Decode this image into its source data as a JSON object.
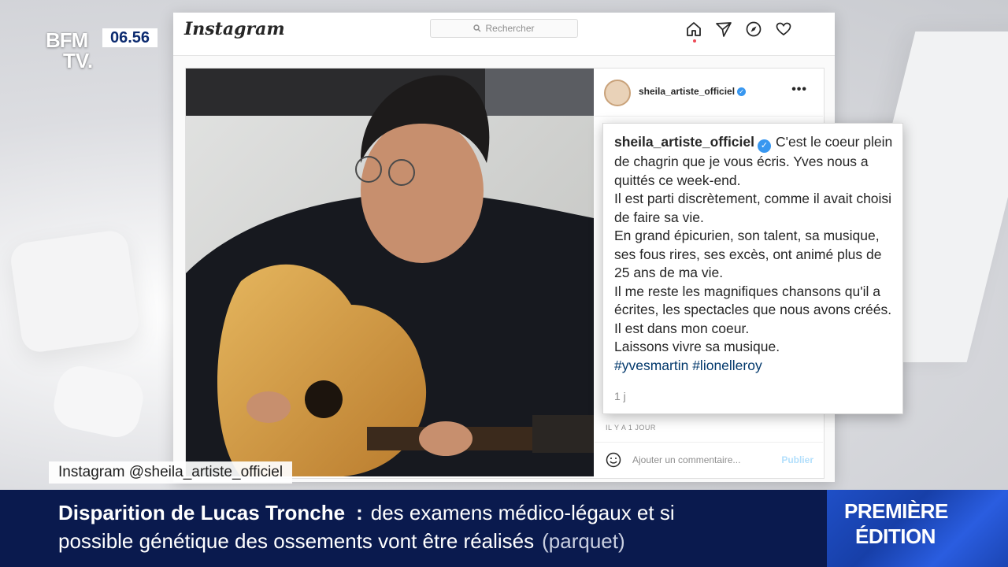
{
  "broadcast": {
    "logo_line1": "BFM",
    "logo_line2": "TV.",
    "clock": "06.56",
    "source_label": "Instagram @sheila_artiste_officiel",
    "headline_bold": "Disparition de Lucas Tronche",
    "headline_sep": ":",
    "headline_rest": "des examens médico-légaux et si",
    "headline_line2": "possible génétique des ossements vont être réalisés",
    "headline_source": "(parquet)",
    "brand_line1": "PREMIÈRE",
    "brand_line2": "ÉDITION"
  },
  "instagram": {
    "wordmark": "Instagram",
    "search_placeholder": "Rechercher",
    "nav_icons": [
      "home-icon",
      "direct-message-icon",
      "explore-icon",
      "heart-icon"
    ],
    "post": {
      "username": "sheila_artiste_officiel",
      "verified": true,
      "more_label": "•••",
      "time_label": "IL Y A 1 JOUR",
      "comment_placeholder": "Ajouter un commentaire...",
      "publish_label": "Publier"
    },
    "caption": {
      "username": "sheila_artiste_officiel",
      "lines": [
        "C'est le coeur plein de chagrin que je vous écris. Yves nous a quittés ce week-end.",
        "Il est parti discrètement, comme il avait choisi de faire sa vie.",
        "En grand épicurien, son talent, sa musique, ses fous rires, ses excès, ont animé plus de 25 ans de ma vie.",
        "Il me reste les magnifiques chansons qu'il a écrites, les spectacles que nous avons créés. Il est dans mon coeur.",
        "Laissons vivre sa musique."
      ],
      "hashtags": "#yvesmartin #lionelleroy",
      "age": "1 j"
    }
  },
  "colors": {
    "ticker_bg": "#0a1a4e",
    "brand_bg": "#1f4fc7",
    "verified": "#3897f0",
    "hashtag": "#00376b"
  }
}
